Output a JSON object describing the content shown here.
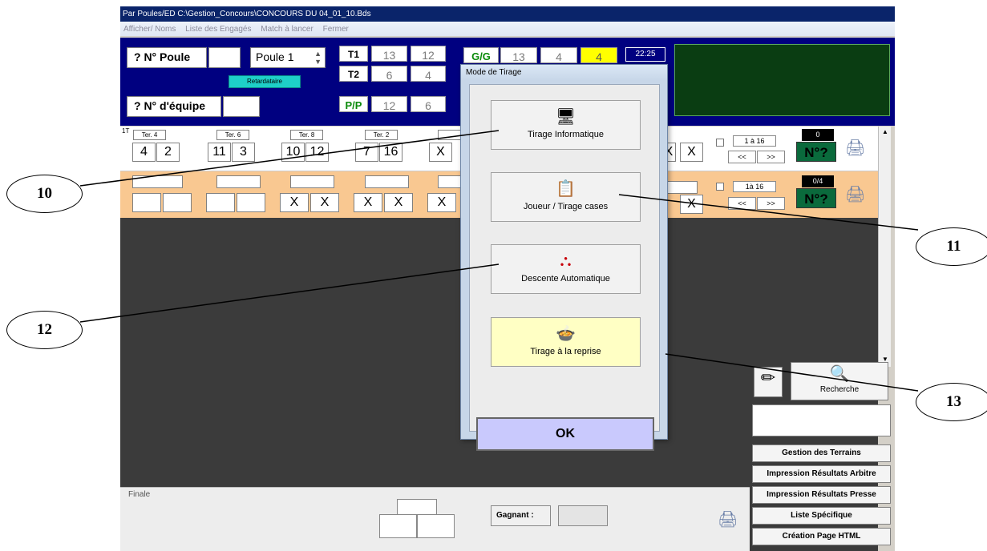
{
  "window": {
    "title": "Par Poules/ED C:\\Gestion_Concours\\CONCOURS DU 04_01_10.Bds",
    "menu": [
      "Afficher/ Noms",
      "Liste des Engagés",
      "Match à lancer",
      "Fermer"
    ]
  },
  "top_panel": {
    "poule_label": "? N° Poule",
    "poule_select": "Poule 1",
    "retardataire": "Retardataire",
    "equipe_label": "? N° d'équipe",
    "t1_label": "T1",
    "t1_a": "13",
    "t1_b": "12",
    "t2_label": "T2",
    "t2_a": "6",
    "t2_b": "4",
    "gg_label": "G/G",
    "gg_a": "13",
    "gg_b": "4",
    "gg_c": "4",
    "pp_label": "P/P",
    "pp_a": "12",
    "pp_b": "6",
    "clock": "22:25"
  },
  "row1": {
    "label": "1T",
    "terrains": [
      "Ter. 4",
      "Ter. 6",
      "Ter. 8",
      "Ter. 2"
    ],
    "scores": [
      "4",
      "2",
      "11",
      "3",
      "10",
      "12",
      "7",
      "16",
      "X"
    ],
    "range": "1 à 16",
    "count": "0",
    "nav_prev": "<<",
    "nav_next": ">>",
    "num_button": "N°?",
    "right_x": [
      "X",
      "X"
    ]
  },
  "row2": {
    "scores": [
      "X",
      "X",
      "X",
      "X",
      "X"
    ],
    "range": "1à 16",
    "count": "0/4",
    "nav_prev": "<<",
    "nav_next": ">>",
    "num_button": "N°?",
    "right_x": [
      "X"
    ]
  },
  "modal": {
    "title": "Mode de Tirage",
    "buttons": [
      {
        "label": "Tirage Informatique",
        "icon": "computer-icon"
      },
      {
        "label": "Joueur / Tirage cases",
        "icon": "player-draw-icon"
      },
      {
        "label": "Descente Automatique",
        "icon": "tree-icon"
      },
      {
        "label": "Tirage à la reprise",
        "icon": "pot-icon"
      }
    ],
    "ok": "OK"
  },
  "right_panel": {
    "search_label": "Recherche",
    "buttons": [
      "Gestion des Terrains",
      "Impression Résultats Arbitre",
      "Impression Résultats Presse",
      "Liste Spécifique",
      "Création Page HTML"
    ]
  },
  "finale": {
    "label": "Finale",
    "winner_label": "Gagnant :"
  },
  "callouts": [
    "10",
    "11",
    "12",
    "13"
  ],
  "colors": {
    "title_bar": "#0a246a",
    "top_panel": "#000080",
    "row2_bg": "#f9c891",
    "highlight_button": "#ffffc4",
    "ok_button": "#c9c9fd"
  }
}
